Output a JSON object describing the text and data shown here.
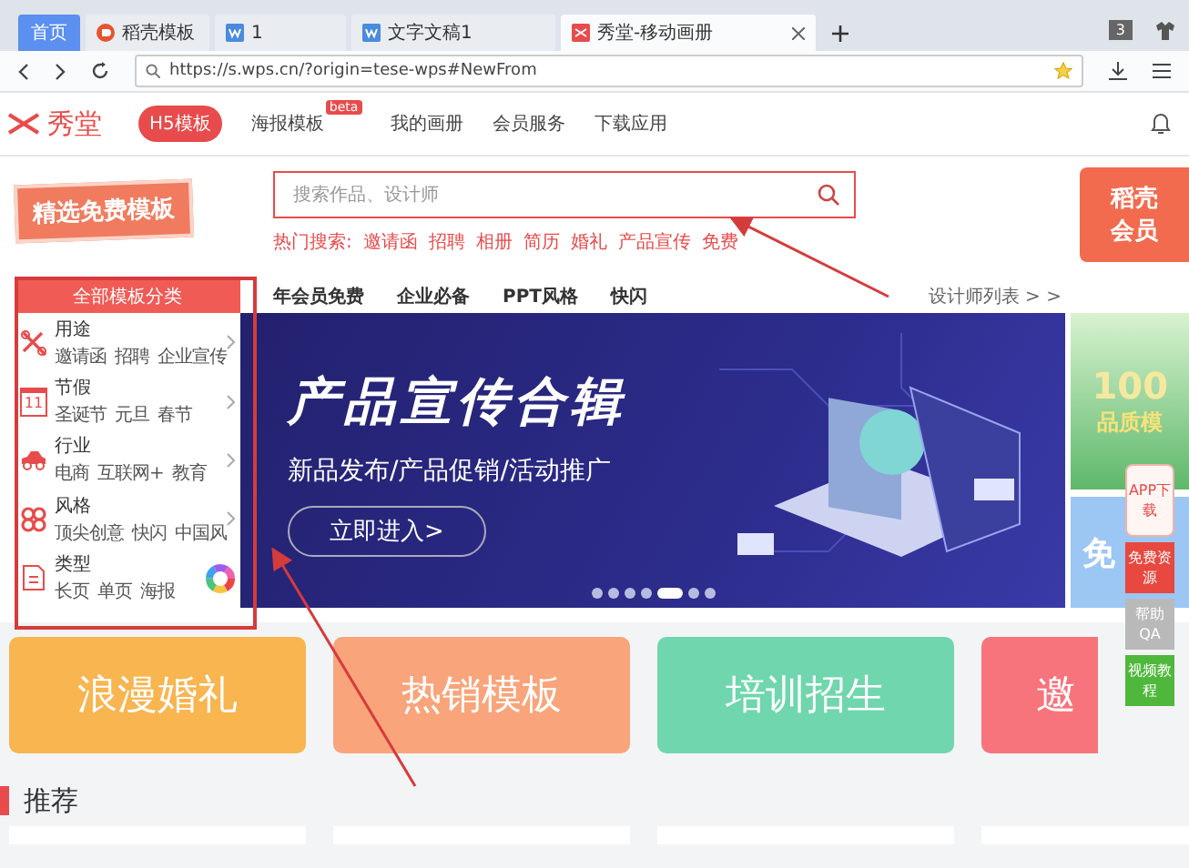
{
  "browser": {
    "tabs": [
      {
        "label": "首页",
        "kind": "home",
        "selected": false
      },
      {
        "label": "稻壳模板",
        "kind": "docer",
        "selected": false
      },
      {
        "label": "1",
        "kind": "doc",
        "selected": false
      },
      {
        "label": "文字文稿1",
        "kind": "doc",
        "selected": false
      },
      {
        "label": "秀堂-移动画册",
        "kind": "xiutang",
        "selected": true
      }
    ],
    "tab_count": "3",
    "address": {
      "value": "https://s.wps.cn/?origin=tese-wps#NewFrom"
    }
  },
  "site_nav": {
    "logo": "秀堂",
    "items": [
      {
        "label": "H5模板",
        "selected": true
      },
      {
        "label": "海报模板",
        "selected": false,
        "badge": "beta"
      },
      {
        "label": "我的画册",
        "selected": false
      },
      {
        "label": "会员服务",
        "selected": false
      },
      {
        "label": "下载应用",
        "selected": false
      }
    ]
  },
  "promo_badge": "精选免费模板",
  "search": {
    "placeholder": "搜索作品、设计师",
    "hot_label": "热门搜索:",
    "hot_terms": [
      "邀请函",
      "招聘",
      "相册",
      "简历",
      "婚礼",
      "产品宣传",
      "免费"
    ]
  },
  "member_promo": [
    "稻壳",
    "会员"
  ],
  "categories": {
    "header": "全部模板分类",
    "items": [
      {
        "title": "用途",
        "kind": "tools",
        "submenu": true,
        "tags": [
          "邀请函",
          "招聘",
          "企业宣传"
        ]
      },
      {
        "title": "节假",
        "kind": "calendar",
        "icon_text": "11",
        "submenu": true,
        "tags": [
          "圣诞节",
          "元旦",
          "春节"
        ]
      },
      {
        "title": "行业",
        "kind": "car",
        "submenu": true,
        "tags": [
          "电商",
          "互联网+",
          "教育"
        ]
      },
      {
        "title": "风格",
        "kind": "pattern",
        "submenu": true,
        "tags": [
          "顶尖创意",
          "快闪",
          "中国风"
        ]
      },
      {
        "title": "类型",
        "kind": "document",
        "submenu": false,
        "tags": [
          "长页",
          "单页",
          "海报"
        ]
      }
    ]
  },
  "filters": {
    "items": [
      "年会员免费",
      "企业必备",
      "PPT风格",
      "快闪"
    ],
    "more": "设计师列表 > >"
  },
  "banner": {
    "title": "产品宣传合辑",
    "subtitle": "新品发布/产品促销/活动推广",
    "button": "立即进入>",
    "slides": [
      {
        "selected": false
      },
      {
        "selected": false
      },
      {
        "selected": false
      },
      {
        "selected": false
      },
      {
        "selected": true
      },
      {
        "selected": false
      },
      {
        "selected": false
      }
    ]
  },
  "side_promos": [
    {
      "kind": "green",
      "lines": [
        "100",
        "品质模"
      ]
    },
    {
      "kind": "blue",
      "lines": [
        "免"
      ]
    }
  ],
  "float_buttons": [
    {
      "label": "APP下载",
      "kind": "app"
    },
    {
      "label": "免费资源",
      "kind": "red"
    },
    {
      "label": "帮助QA",
      "kind": "grey"
    },
    {
      "label": "视频教程",
      "kind": "green"
    }
  ],
  "tiles": [
    {
      "label": "浪漫婚礼",
      "color": "#f8b550"
    },
    {
      "label": "热销模板",
      "color": "#f9a47a"
    },
    {
      "label": "培训招生",
      "color": "#6fd6ad"
    },
    {
      "label": "邀",
      "color": "#f7747c"
    }
  ],
  "section_title": "推荐"
}
